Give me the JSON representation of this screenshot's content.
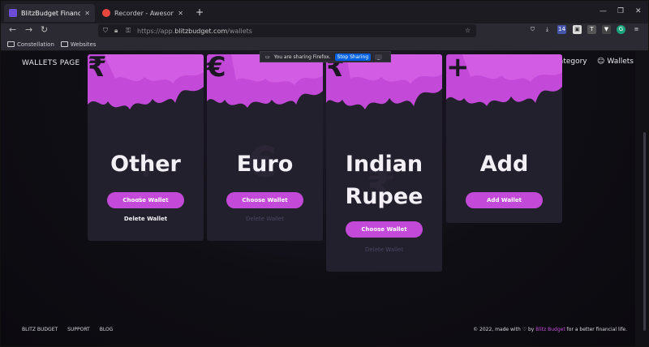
{
  "browser": {
    "tabs": [
      {
        "title": "BlitzBudget Financial Analyzer",
        "active": true
      },
      {
        "title": "Recorder - Awesome Screenshot",
        "active": false
      }
    ],
    "url_prefix": "https://app.",
    "url_host": "blitzbudget.com",
    "url_path": "/wallets",
    "bookmarks": [
      "Constellation",
      "Websites"
    ],
    "new_tab": "+",
    "extension_badge": "14",
    "icons": {
      "back": "←",
      "forward": "→",
      "reload": "↻",
      "star": "☆",
      "download": "⤓",
      "menu": "≡"
    }
  },
  "sharing_bar": {
    "text": "You are sharing Firefox.",
    "stop_label": "Stop Sharing",
    "minimize_label": "_"
  },
  "header": {
    "title": "WALLETS PAGE",
    "nav": [
      {
        "label": "Category",
        "icon": "category-icon"
      },
      {
        "label": "Wallets",
        "icon": "user-icon"
      }
    ]
  },
  "wallets": [
    {
      "symbol": "₹",
      "name_lines": [
        "Other"
      ],
      "ghost": "+",
      "choose_label": "Choose Wallet",
      "delete_label": "Delete Wallet",
      "delete_enabled": true
    },
    {
      "symbol": "€",
      "name_lines": [
        "Euro"
      ],
      "ghost": "€",
      "choose_label": "Choose Wallet",
      "delete_label": "Delete Wallet",
      "delete_enabled": false
    },
    {
      "symbol": "₹",
      "name_lines": [
        "Indian",
        "Rupee"
      ],
      "ghost": "₹",
      "choose_label": "Choose Wallet",
      "delete_label": "Delete Wallet",
      "delete_enabled": false
    },
    {
      "symbol": "+",
      "name_lines": [
        "Add"
      ],
      "ghost": "",
      "choose_label": "Add Wallet",
      "delete_label": "",
      "delete_enabled": false
    }
  ],
  "footer": {
    "links": [
      "BLITZ BUDGET",
      "SUPPORT",
      "BLOG"
    ],
    "credit_prefix": "© 2022, made with",
    "credit_heart": "♡",
    "credit_by": "by",
    "credit_brand": "Blitz Budget",
    "credit_suffix": "for a better financial life."
  },
  "colors": {
    "accent": "#c34ad8",
    "card_bg": "#23202e",
    "page_bg": "#0f0e14"
  }
}
